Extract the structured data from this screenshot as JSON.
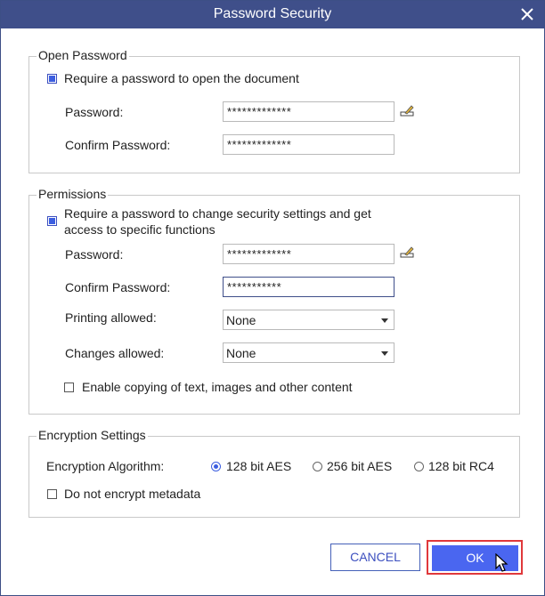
{
  "window": {
    "title": "Password Security",
    "close_icon": "close-icon"
  },
  "open_password": {
    "legend": "Open Password",
    "require_label": "Require a password to open the document",
    "require_checked": true,
    "password_label": "Password:",
    "password_value": "*************",
    "confirm_label": "Confirm Password:",
    "confirm_value": "*************"
  },
  "permissions": {
    "legend": "Permissions",
    "require_label_line1": "Require a password to change security settings and get",
    "require_label_line2": "access to specific functions",
    "require_checked": true,
    "password_label": "Password:",
    "password_value": "*************",
    "confirm_label": "Confirm Password:",
    "confirm_value": "***********",
    "printing_label": "Printing allowed:",
    "printing_value": "None",
    "changes_label": "Changes allowed:",
    "changes_value": "None",
    "copy_label": "Enable copying of text, images and other content",
    "copy_checked": false
  },
  "encryption": {
    "legend": "Encryption Settings",
    "algorithm_label": "Encryption Algorithm:",
    "options": [
      "128 bit AES",
      "256 bit AES",
      "128 bit RC4"
    ],
    "selected": "128 bit AES",
    "metadata_label": "Do not encrypt metadata",
    "metadata_checked": false
  },
  "buttons": {
    "cancel": "CANCEL",
    "ok": "OK"
  },
  "colors": {
    "titlebar": "#3f4f8a",
    "accent": "#4a66f0",
    "highlight": "#e0383b"
  }
}
